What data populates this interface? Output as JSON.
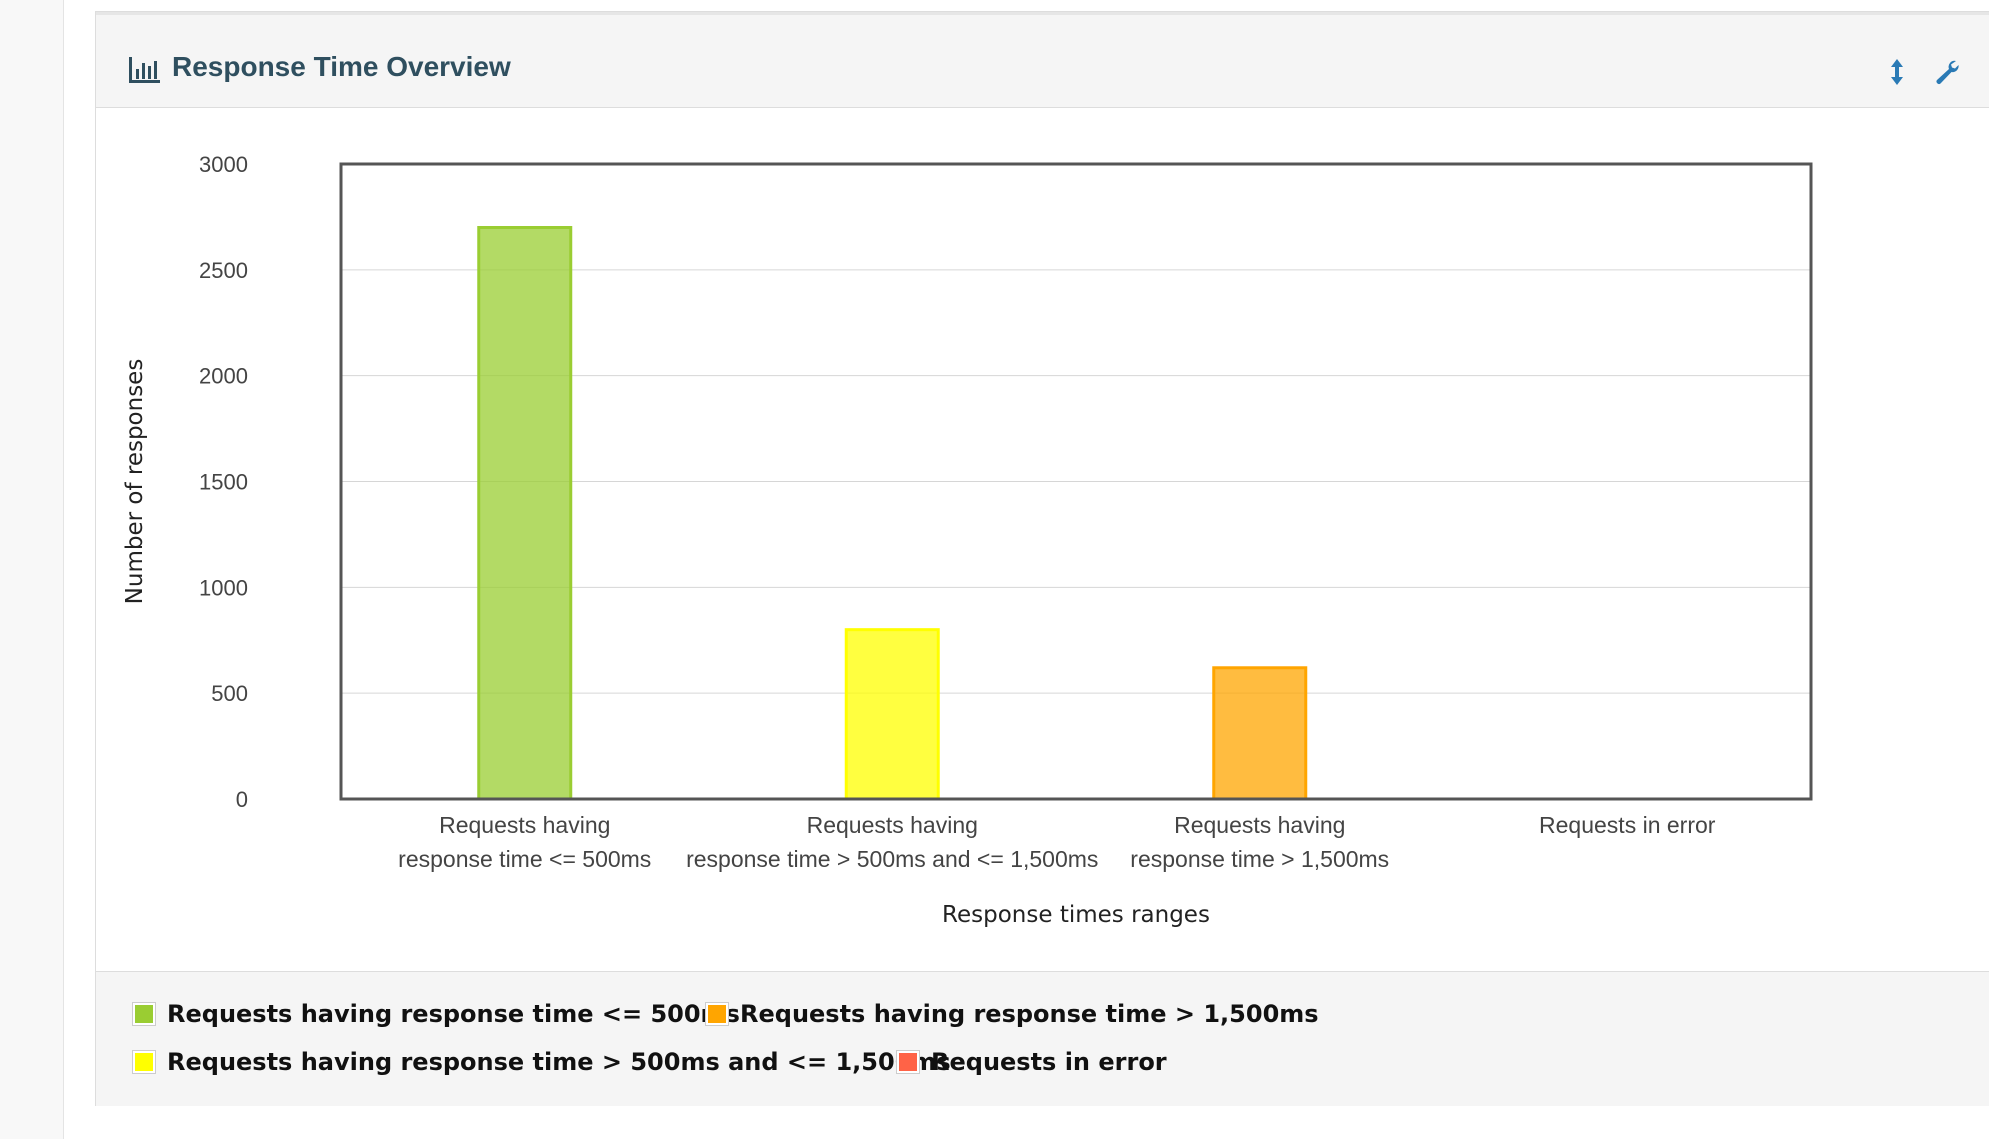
{
  "panel": {
    "title": "Response Time Overview",
    "title_icon": "bar-chart-icon",
    "tools": [
      {
        "name": "expand-collapse",
        "icon": "vertical-arrows-icon"
      },
      {
        "name": "settings",
        "icon": "wrench-icon"
      }
    ]
  },
  "chart_data": {
    "type": "bar",
    "title": "",
    "xlabel": "Response times ranges",
    "ylabel": "Number of responses",
    "ylim": [
      0,
      3000
    ],
    "yticks": [
      0,
      500,
      1000,
      1500,
      2000,
      2500,
      3000
    ],
    "grid": true,
    "legend_position": "bottom",
    "categories": [
      {
        "label_lines": [
          "Requests having",
          "response time <= 500ms"
        ]
      },
      {
        "label_lines": [
          "Requests having",
          "response time > 500ms and <= 1,500ms"
        ]
      },
      {
        "label_lines": [
          "Requests having",
          "response time > 1,500ms"
        ]
      },
      {
        "label_lines": [
          "Requests in error"
        ]
      }
    ],
    "series": [
      {
        "name": "Requests having response time <= 500ms",
        "color": "#9ACD32",
        "values": [
          2700,
          null,
          null,
          null
        ]
      },
      {
        "name": "Requests having response time > 500ms and <= 1,500ms",
        "color": "#FFFF00",
        "values": [
          null,
          800,
          null,
          null
        ]
      },
      {
        "name": "Requests having response time > 1,500ms",
        "color": "#FFA500",
        "values": [
          null,
          null,
          620,
          null
        ]
      },
      {
        "name": "Requests in error",
        "color": "#FF6347",
        "values": [
          null,
          null,
          null,
          0
        ]
      }
    ]
  },
  "legend": {
    "rows": [
      [
        0,
        2
      ],
      [
        1,
        3
      ]
    ]
  }
}
